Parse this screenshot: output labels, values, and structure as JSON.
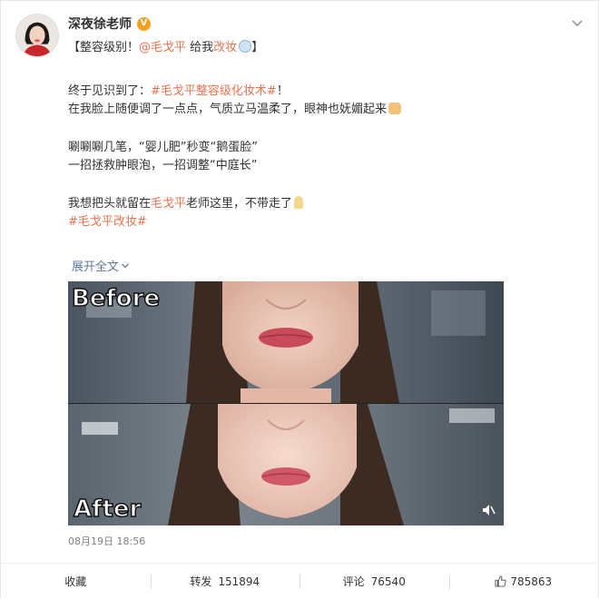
{
  "author": {
    "name": "深夜徐老师",
    "verified_badge": "V"
  },
  "header": {
    "subtitle_prefix": "【整容级别！",
    "mention": "@毛戈平",
    "subtitle_mid": " 给我",
    "subtitle_link": "改妆",
    "subtitle_suffix": "】",
    "more_icon": "chevron-down-icon"
  },
  "body": {
    "line1_prefix": "终于见识到了：",
    "line1_tag": "#毛戈平整容级化妆术#",
    "line1_suffix": "！",
    "line2": "在我脸上随便调了一点点，气质立马温柔了，眼神也妩媚起来",
    "line3": "唰唰唰几笔，“婴儿肥”秒变“鹅蛋脸”",
    "line4": "一招拯救肿眼泡，一招调整“中庭长”",
    "line5_prefix": "我想把头就留在",
    "line5_link": "毛戈平",
    "line5_suffix": "老师这里，不带走了",
    "line6_tag": "#毛戈平改妆#",
    "expand_label": "展开全文"
  },
  "media": {
    "before_label": "Before",
    "after_label": "After"
  },
  "timestamp": "08月19日 18:56",
  "actions": {
    "favorite_label": "收藏",
    "repost_label": "转发",
    "repost_count": "151894",
    "comment_label": "评论",
    "comment_count": "76540",
    "like_count": "785863"
  },
  "colors": {
    "accent": "#eb7350",
    "link": "#5d7a99",
    "muted": "#808080"
  }
}
